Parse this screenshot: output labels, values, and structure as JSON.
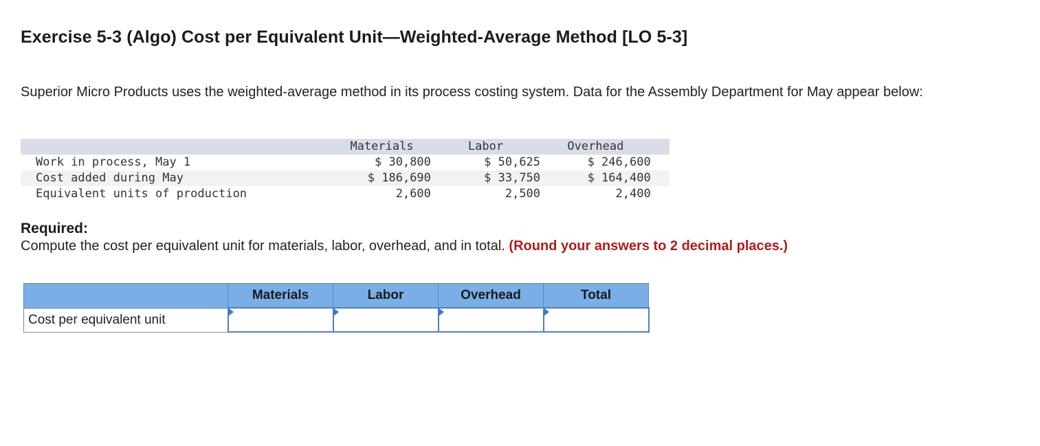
{
  "title": "Exercise 5-3 (Algo) Cost per Equivalent Unit—Weighted-Average Method [LO 5-3]",
  "intro": "Superior Micro Products uses the weighted-average method in its process costing system. Data for the Assembly Department for May appear below:",
  "data_table": {
    "headers": [
      "Materials",
      "Labor",
      "Overhead"
    ],
    "rows": [
      {
        "label": "Work in process, May 1",
        "values": [
          "$ 30,800",
          "$ 50,625",
          "$ 246,600"
        ]
      },
      {
        "label": "Cost added during May",
        "values": [
          "$ 186,690",
          "$ 33,750",
          "$ 164,400"
        ]
      },
      {
        "label": "Equivalent units of production",
        "values": [
          "2,600",
          "2,500",
          "2,400"
        ]
      }
    ]
  },
  "required": {
    "heading": "Required:",
    "text": "Compute the cost per equivalent unit for materials, labor, overhead, and in total.",
    "note": "(Round your answers to 2 decimal places.)"
  },
  "answer_table": {
    "headers": [
      "Materials",
      "Labor",
      "Overhead",
      "Total"
    ],
    "row_label": "Cost per equivalent unit",
    "values": [
      "",
      "",
      "",
      ""
    ]
  },
  "colors": {
    "header_blue": "#7aaee6",
    "note_red": "#b01c1c",
    "input_border": "#4f7fbf",
    "data_header_bg": "#d9dde8"
  }
}
